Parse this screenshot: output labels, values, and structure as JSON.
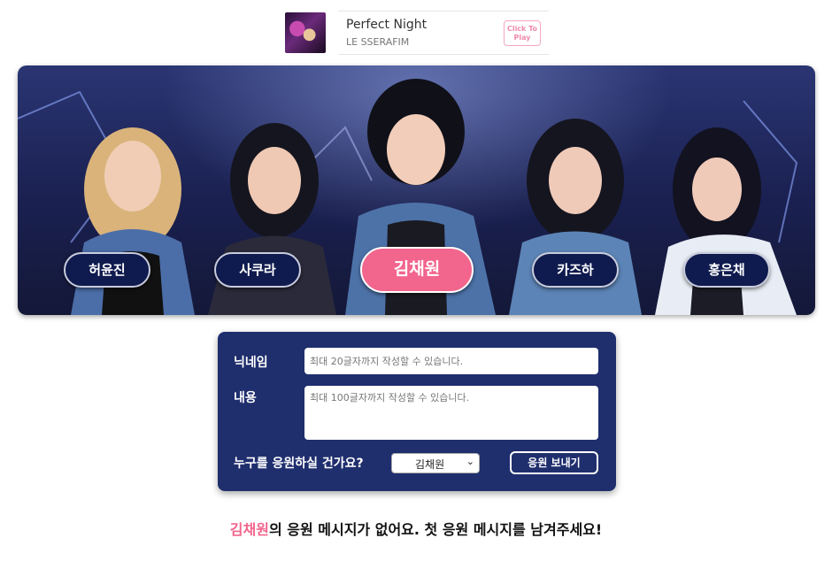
{
  "player": {
    "song_title": "Perfect Night",
    "artist": "LE SSERAFIM",
    "play_label_line1": "Click To",
    "play_label_line2": "Play",
    "album_icon": "album-art-image"
  },
  "banner": {
    "members": [
      {
        "label": "허윤진",
        "active": false
      },
      {
        "label": "사쿠라",
        "active": false
      },
      {
        "label": "김채원",
        "active": true
      },
      {
        "label": "카즈하",
        "active": false
      },
      {
        "label": "홍은채",
        "active": false
      }
    ],
    "active_color": "#f2658d",
    "button_color": "#0f1a4e"
  },
  "form": {
    "nickname_label": "닉네임",
    "nickname_placeholder": "최대 20글자까지 작성할 수 있습니다.",
    "content_label": "내용",
    "content_placeholder": "최대 100글자까지 작성할 수 있습니다.",
    "question_label": "누구를 응원하실 건가요?",
    "selected_member": "김채원",
    "send_label": "응원 보내기"
  },
  "empty_message": {
    "highlight": "김채원",
    "rest": "의 응원 메시지가 없어요. 첫 응원 메시지를 남겨주세요!"
  },
  "colors": {
    "form_bg": "#1f2e6d",
    "accent_pink": "#f2658d"
  }
}
